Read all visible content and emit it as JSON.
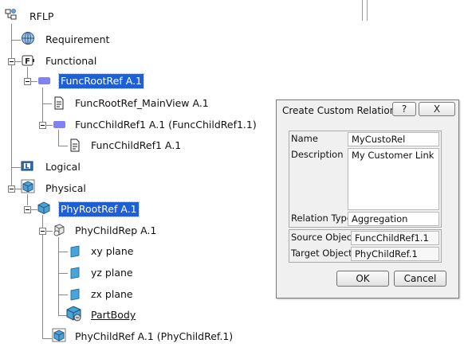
{
  "tree": {
    "root": {
      "label": "RFLP",
      "icon": "rflp-tree-icon"
    },
    "requirement": {
      "label": "Requirement",
      "icon": "requirement-globe-icon"
    },
    "functional": {
      "label": "Functional",
      "icon": "functional-F-icon"
    },
    "func_root_ref": {
      "label": "FuncRootRef A.1",
      "icon": "func-reference-icon",
      "selected": true
    },
    "func_root_ref_mainview": {
      "label": "FuncRootRef_MainView A.1",
      "icon": "document-view-icon"
    },
    "func_child_ref1": {
      "label": "FuncChildRef1 A.1 (FuncChildRef1.1)",
      "icon": "func-reference-icon"
    },
    "func_child_ref1_leaf": {
      "label": "FuncChildRef1 A.1",
      "icon": "document-view-icon"
    },
    "logical": {
      "label": "Logical",
      "icon": "logical-L-icon"
    },
    "physical": {
      "label": "Physical",
      "icon": "physical-cube-icon"
    },
    "phy_root_ref": {
      "label": "PhyRootRef A.1",
      "icon": "product-cube-icon",
      "selected": true
    },
    "phy_child_rep": {
      "label": "PhyChildRep A.1",
      "icon": "part-representation-icon"
    },
    "xy_plane": {
      "label": "xy plane",
      "icon": "plane-icon"
    },
    "yz_plane": {
      "label": "yz plane",
      "icon": "plane-icon"
    },
    "zx_plane": {
      "label": "zx plane",
      "icon": "plane-icon"
    },
    "part_body": {
      "label": "PartBody",
      "icon": "part-body-icon"
    },
    "phy_child_ref": {
      "label": "PhyChildRef A.1 (PhyChildRef.1)",
      "icon": "product-cube-icon"
    }
  },
  "dialog": {
    "title": "Create Custom Relation",
    "help_label": "?",
    "close_label": "X",
    "name_label": "Name",
    "name_value": "MyCustoRel",
    "description_label": "Description",
    "description_value": "My Customer Link",
    "relation_type_label": "Relation Type",
    "relation_type_value": "Aggregation",
    "source_object_label": "Source Object",
    "source_object_value": "FuncChildRef1.1",
    "target_object_label": "Target Object",
    "target_object_value": "PhyChildRef.1",
    "ok_label": "OK",
    "cancel_label": "Cancel"
  },
  "colors": {
    "selection": "#1e5fd6",
    "func_reference": "#7f82f0",
    "physical_blue": "#4aa3d6"
  }
}
